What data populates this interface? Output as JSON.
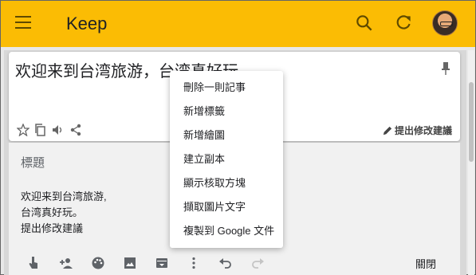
{
  "app": {
    "title": "Keep"
  },
  "colors": {
    "appbar": "#fbbc04",
    "card": "#ffffff",
    "panel": "#f1f1f1"
  },
  "header": {
    "icons": [
      "menu-icon",
      "search-icon",
      "refresh-icon",
      "avatar"
    ]
  },
  "note": {
    "title": "欢迎来到台湾旅游，台湾真好玩",
    "suggest_label": "提出修改建議"
  },
  "editor": {
    "title_placeholder": "標題",
    "body_lines": [
      "欢迎来到台湾旅游,",
      "台湾真好玩。",
      "提出修改建議"
    ],
    "close_label": "關閉"
  },
  "menu": {
    "items": [
      "刪除一則記事",
      "新增標籤",
      "新增繪圖",
      "建立副本",
      "顯示核取方塊",
      "擷取圖片文字",
      "複製到 Google 文件"
    ]
  }
}
